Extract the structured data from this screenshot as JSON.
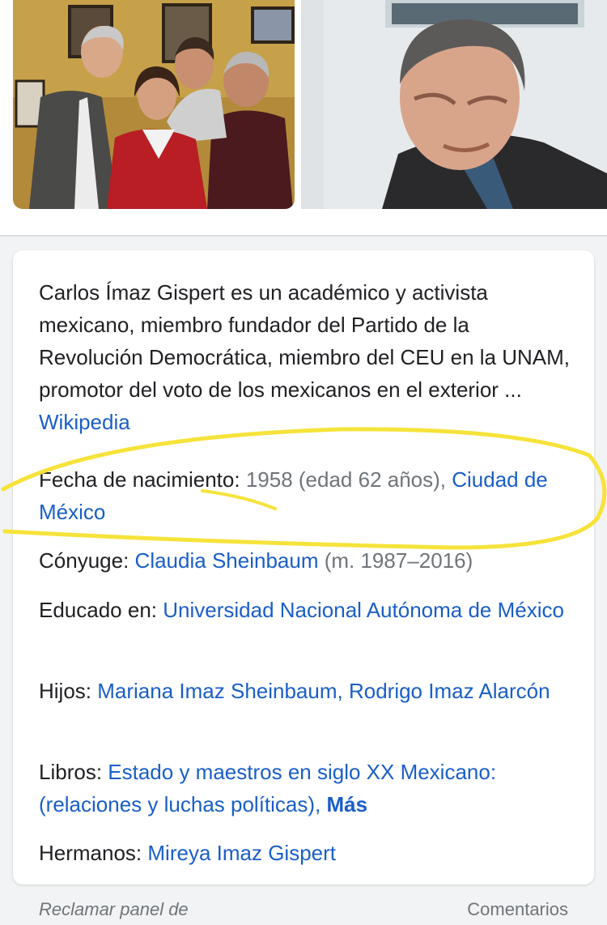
{
  "images": {
    "photo_1": "group photo of four people",
    "photo_2": "portrait of an older man"
  },
  "description": {
    "text": "Carlos Ímaz Gispert es un académico y activista mexicano, miembro fundador del Partido de la Revolución Democrática, miembro del CEU en la UNAM, promotor del voto de los mexicanos en el exterior ... ",
    "source_link": "Wikipedia"
  },
  "facts": {
    "birth": {
      "label": "Fecha de nacimiento:",
      "value": " 1958 (edad 62 años), ",
      "link": "Ciudad de México"
    },
    "spouse": {
      "label": "Cónyuge:",
      "link": "Claudia Sheinbaum",
      "value": " (m. 1987–2016)"
    },
    "education": {
      "label": "Educado en:",
      "link": "Universidad Nacional Autónoma de México"
    },
    "children": {
      "label": "Hijos:",
      "links": [
        "Mariana Imaz Sheinbaum",
        "Rodrigo Imaz Alarcón"
      ],
      "separator": ", "
    },
    "books": {
      "label": "Libros:",
      "link": "Estado y maestros en siglo XX Mexicano: (relaciones y luchas políticas)",
      "separator": ", ",
      "more": "Más"
    },
    "siblings": {
      "label": "Hermanos:",
      "link": "Mireya Imaz Gispert"
    }
  },
  "footer": {
    "claim": "Reclamar panel de",
    "feedback": "Comentarios"
  },
  "colors": {
    "link": "#1a5ec7",
    "highlight": "#f6e33a",
    "muted": "#70757a"
  }
}
